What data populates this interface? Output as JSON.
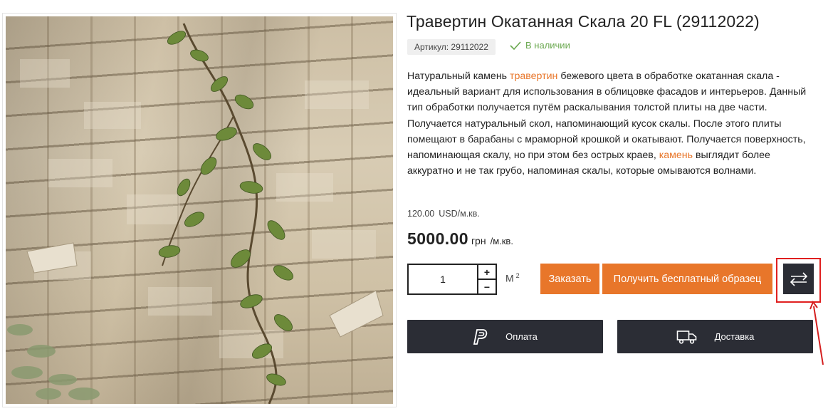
{
  "product": {
    "title": "Травертин Окатанная Скала 20 FL (29112022)",
    "sku_label": "Артикул: 29112022",
    "stock_status": "В наличии",
    "description": {
      "part1": "Натуральный камень ",
      "link1": "травертин",
      "part2": " бежевого цвета в обработке окатанная скала - идеальный вариант для использования в облицовке фасадов и интерьеров. Данный тип обработки получается путём раскалывания толстой плиты на две части. Получается натуральный скол, напоминающий кусок скалы. После этого плиты помещают в барабаны с мраморной крошкой и окатывают. Получается поверхность, напоминающая скалу, но при этом без острых краев, ",
      "link2": "камень",
      "part3": " выглядит более аккуратно и не так грубо, напоминая скалы, которые омываются волнами."
    },
    "price_usd": "120.00",
    "price_usd_unit": "USD/м.кв.",
    "price_uah": "5000.00",
    "price_uah_currency": "грн",
    "price_uah_unit": "/м.кв."
  },
  "quantity": {
    "value": "1",
    "plus": "+",
    "minus": "−",
    "unit": "М",
    "unit_power": "2"
  },
  "buttons": {
    "order": "Заказать",
    "sample": "Получить бесплатный образец",
    "compare_icon": "compare-arrows-icon",
    "payment": "Оплата",
    "payment_icon": "paypal-icon",
    "delivery": "Доставка",
    "delivery_icon": "truck-icon"
  },
  "colors": {
    "accent": "#e8762a",
    "dark": "#2b2d35",
    "stock_green": "#6aa84f",
    "highlight": "#e02020"
  }
}
